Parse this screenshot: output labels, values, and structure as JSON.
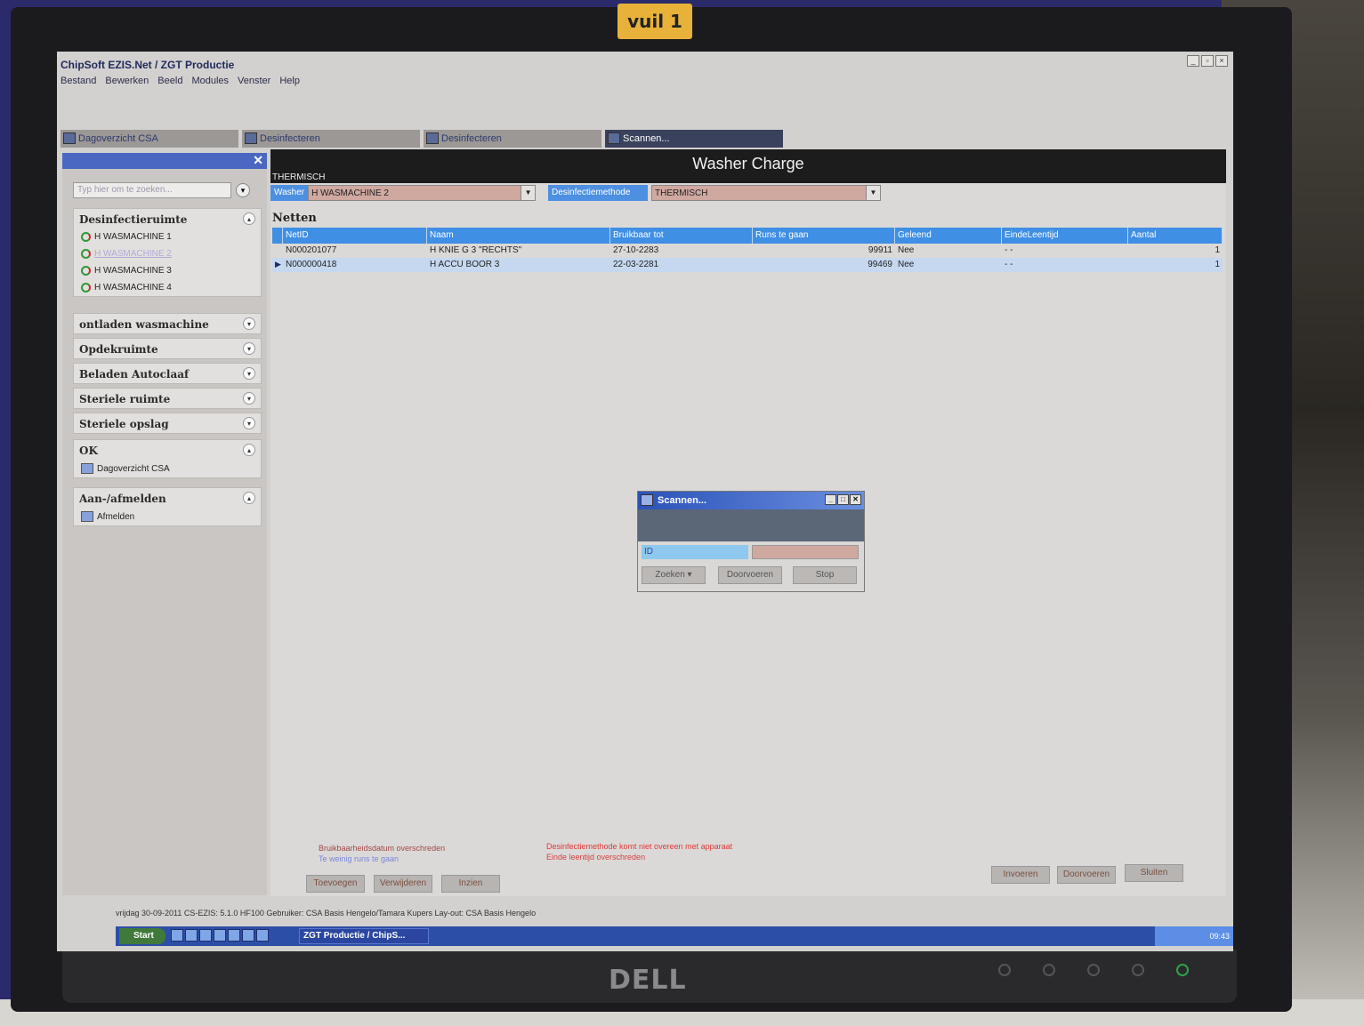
{
  "photo": {
    "sticker": "vuil  1",
    "brand": "DELL"
  },
  "window": {
    "title": "ChipSoft EZIS.Net / ZGT Productie",
    "controls": [
      "_",
      "▫",
      "×"
    ]
  },
  "menu": [
    "Bestand",
    "Bewerken",
    "Beeld",
    "Modules",
    "Venster",
    "Help"
  ],
  "tabs": [
    {
      "label": "Dagoverzicht CSA"
    },
    {
      "label": "Desinfecteren"
    },
    {
      "label": "Desinfecteren"
    },
    {
      "label": "Scannen..."
    }
  ],
  "sidebar": {
    "search_placeholder": "Typ hier om te zoeken...",
    "groups": [
      {
        "title": "Desinfectieruimte",
        "items": [
          "H WASMACHINE 1",
          "H WASMACHINE 2",
          "H WASMACHINE 3",
          "H WASMACHINE 4"
        ]
      },
      {
        "title": "ontladen wasmachine"
      },
      {
        "title": "Opdekruimte"
      },
      {
        "title": "Beladen Autoclaaf"
      },
      {
        "title": "Steriele ruimte"
      },
      {
        "title": "Steriele opslag"
      },
      {
        "title": "OK",
        "items": [
          "Dagoverzicht CSA"
        ]
      },
      {
        "title": "Aan-/afmelden",
        "items": [
          "Afmelden"
        ]
      }
    ]
  },
  "main": {
    "title": "Washer Charge",
    "subtitle": "THERMISCH",
    "washer_label": "Washer",
    "washer_value": "H WASMACHINE 2",
    "method_label": "Desinfectiemethode",
    "method_value": "THERMISCH",
    "section": "Netten",
    "columns": [
      "NetID",
      "Naam",
      "Bruikbaar tot",
      "Runs te gaan",
      "Geleend",
      "EindeLeentijd",
      "Aantal"
    ],
    "rows": [
      [
        "N000201077",
        "H KNIE G 3 \"RECHTS\"",
        "27-10-2283",
        "99911",
        "Nee",
        "- -",
        "1"
      ],
      [
        "N000000418",
        "H ACCU BOOR 3",
        "22-03-2281",
        "99469",
        "Nee",
        "- -",
        "1"
      ]
    ],
    "legend": [
      "Bruikbaarheidsdatum overschreden",
      "Te weinig runs te gaan",
      "Desinfectiemethode komt niet overeen met apparaat",
      "Einde leentijd overschreden"
    ],
    "buttons_left": [
      "Toevoegen",
      "Verwijderen",
      "Inzien"
    ],
    "buttons_right": [
      "Invoeren",
      "Doorvoeren",
      "Sluiten"
    ]
  },
  "dialog": {
    "title": "Scannen...",
    "id_label": "ID",
    "id_value": "",
    "buttons": [
      "Zoeken",
      "Doorvoeren",
      "Stop"
    ]
  },
  "statusbar": "vrijdag 30-09-2011   CS-EZIS: 5.1.0 HF100   Gebruiker: CSA Basis Hengelo/Tamara Kupers   Lay-out: CSA  Basis Hengelo",
  "taskbar": {
    "start": "Start",
    "task": "ZGT Productie / ChipS...",
    "clock": "09:43"
  }
}
